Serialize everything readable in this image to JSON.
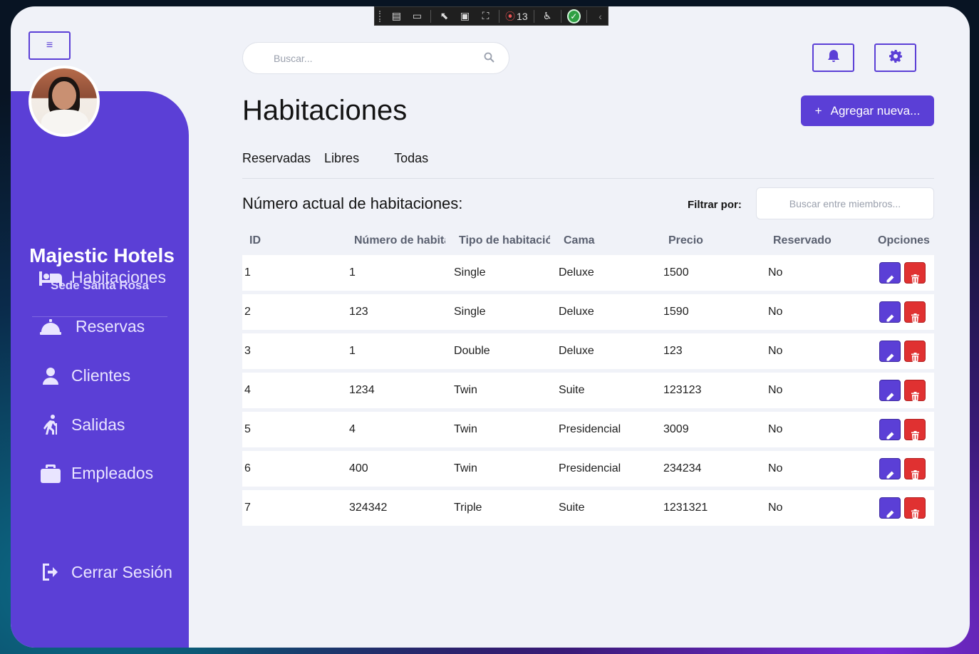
{
  "devtools": {
    "counter": "13"
  },
  "sidebar": {
    "brand": "Majestic Hotels",
    "sede": "Sede Santa Rosa",
    "items": [
      {
        "label": "Habitaciones",
        "icon": "bed-icon"
      },
      {
        "label": "Reservas",
        "icon": "service-bell-icon"
      },
      {
        "label": "Clientes",
        "icon": "user-icon"
      },
      {
        "label": "Salidas",
        "icon": "walking-icon"
      },
      {
        "label": "Empleados",
        "icon": "briefcase-icon"
      }
    ],
    "logout": "Cerrar Sesión"
  },
  "header": {
    "search_placeholder": "Buscar...",
    "page_title": "Habitaciones",
    "add_button": "Agregar nueva...",
    "add_button_icon": "+"
  },
  "tabs": [
    "Reservadas",
    "Libres",
    "Todas"
  ],
  "section": {
    "subtitle": "Número actual de habitaciones:",
    "filter_label": "Filtrar por:",
    "filter_placeholder": "Buscar entre miembros..."
  },
  "table": {
    "columns": [
      "ID",
      "Número de habitación",
      "Tipo de habitación",
      "Cama",
      "Precio",
      "Reservado",
      "Opciones"
    ],
    "rows": [
      [
        "1",
        "1",
        "Single",
        "Deluxe",
        "1500",
        "No"
      ],
      [
        "2",
        "123",
        "Single",
        "Deluxe",
        "1590",
        "No"
      ],
      [
        "3",
        "1",
        "Double",
        "Deluxe",
        "123",
        "No"
      ],
      [
        "4",
        "1234",
        "Twin",
        "Suite",
        "123123",
        "No"
      ],
      [
        "5",
        "4",
        "Twin",
        "Presidencial",
        "3009",
        "No"
      ],
      [
        "6",
        "400",
        "Twin",
        "Presidencial",
        "234234",
        "No"
      ],
      [
        "7",
        "324342",
        "Triple",
        "Suite",
        "1231321",
        "No"
      ]
    ]
  },
  "colors": {
    "accent": "#5b3fd6",
    "danger": "#e03131",
    "background": "#f0f2f8"
  }
}
